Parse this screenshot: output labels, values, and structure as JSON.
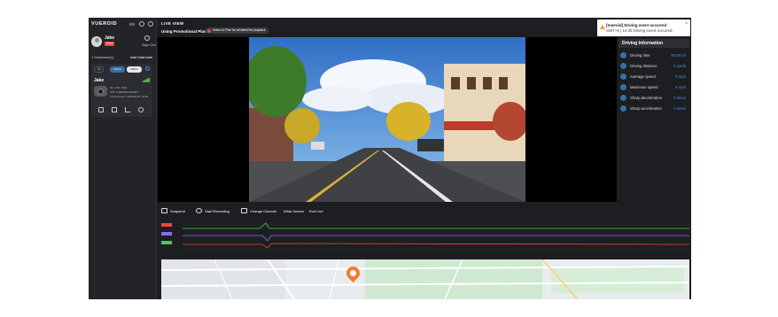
{
  "sidebar": {
    "brand": "VUEROID",
    "lang": "EN",
    "user": {
      "name": "Jake",
      "badge": "Free"
    },
    "signout_label": "Sign Out",
    "dashcam_count": "1 Dashcam(s)",
    "add_dashcam": "Add Dashcam",
    "card": {
      "chips": [
        "All",
        "Online",
        "Offline"
      ],
      "name": "Jake",
      "info": [
        "S1 | LTE, FHD",
        "S/N: VUEROID1234567",
        "Last Connect: 2024-01-01 10:00"
      ]
    }
  },
  "main": {
    "live_title": "LIVE VIEW",
    "promo_text": "Using Promotional Plan",
    "promo_pill": "Switch to Plan for unlimited live playback",
    "controls": [
      "Snapshot",
      "Start Recording",
      "Change Channel",
      "Wide Screen",
      "End Live"
    ],
    "graph_labels": [
      "X-Axis",
      "Y-Axis",
      "Z-Axis"
    ],
    "graph_y_ticks": [
      "0",
      "2"
    ],
    "map_labels": [
      "Wonju-si",
      "Seoul-ro",
      "Park"
    ]
  },
  "driving_info": {
    "title": "Driving Information",
    "rows": [
      {
        "label": "Driving time",
        "value": "00:00:04"
      },
      {
        "label": "Driving distance",
        "value": "0 yards"
      },
      {
        "label": "Average speed",
        "value": "0 mph"
      },
      {
        "label": "Maximum speed",
        "value": "0 mph"
      },
      {
        "label": "Sharp deceleration",
        "value": "0 times"
      },
      {
        "label": "Sharp acceleration",
        "value": "0 times"
      }
    ]
  },
  "notification": {
    "title": "[Vueroid] Driving event occurred",
    "body": "GMT+9 | 14:30 Driving event occurred.",
    "close": "×"
  },
  "colors": {
    "accent": "#4a90e2",
    "badge_red": "#e84a3c",
    "graph_green": "#3ecf5a",
    "graph_purple": "#8a6cf0",
    "graph_red": "#e84a3c",
    "map_pin": "#f07c2e"
  },
  "icons": [
    "bell-icon",
    "settings-icon",
    "signout-icon",
    "refresh-icon",
    "signal-icon",
    "camera-icon",
    "folder-icon",
    "chart-icon",
    "gear-icon",
    "info-icon",
    "warning-icon"
  ]
}
